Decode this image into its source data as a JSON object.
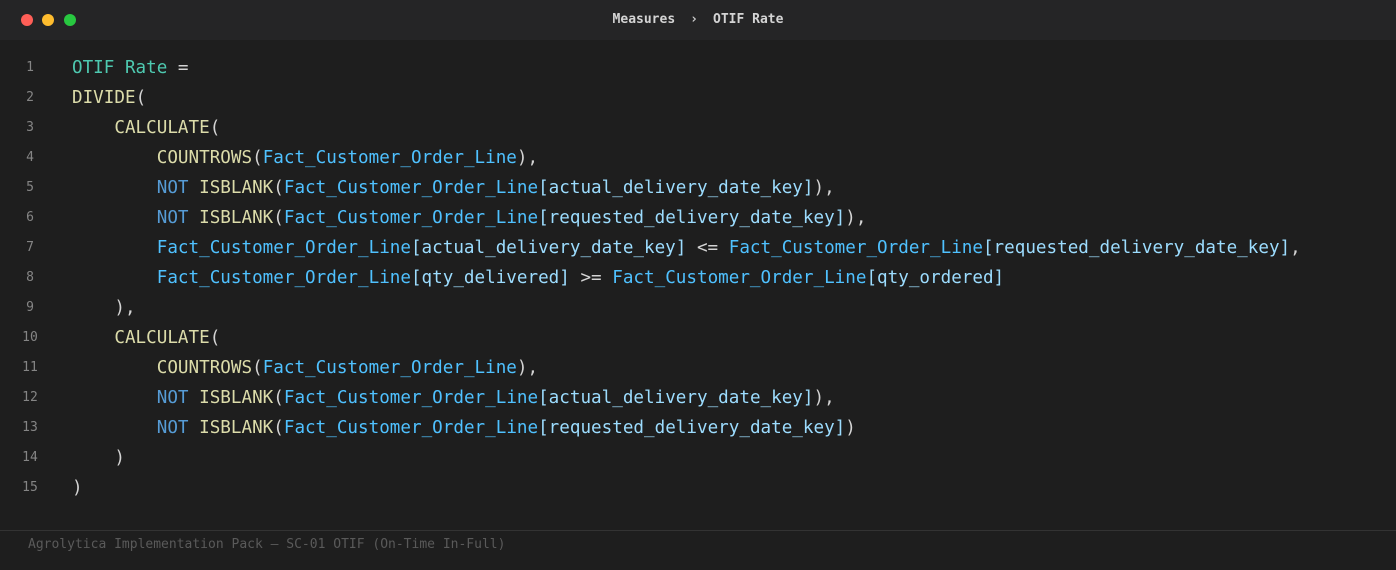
{
  "window": {
    "controls": [
      "close",
      "minimize",
      "maximize"
    ],
    "colors": {
      "close": "#ff5f57",
      "minimize": "#febc2e",
      "maximize": "#28c840"
    }
  },
  "breadcrumb": {
    "parent": "Measures",
    "separator": "›",
    "current": "OTIF Rate"
  },
  "editor": {
    "language": "DAX",
    "lines": [
      {
        "number": "1",
        "tokens": [
          {
            "t": "OTIF Rate",
            "k": "measure"
          },
          {
            "t": " =",
            "k": "punct"
          }
        ]
      },
      {
        "number": "2",
        "tokens": [
          {
            "t": "DIVIDE",
            "k": "func"
          },
          {
            "t": "(",
            "k": "punct"
          }
        ]
      },
      {
        "number": "3",
        "tokens": [
          {
            "t": "    ",
            "k": "punct"
          },
          {
            "t": "CALCULATE",
            "k": "func"
          },
          {
            "t": "(",
            "k": "punct"
          }
        ]
      },
      {
        "number": "4",
        "tokens": [
          {
            "t": "        ",
            "k": "punct"
          },
          {
            "t": "COUNTROWS",
            "k": "func"
          },
          {
            "t": "(",
            "k": "punct"
          },
          {
            "t": "Fact_Customer_Order_Line",
            "k": "table"
          },
          {
            "t": "),",
            "k": "punct"
          }
        ]
      },
      {
        "number": "5",
        "tokens": [
          {
            "t": "        ",
            "k": "punct"
          },
          {
            "t": "NOT",
            "k": "kw"
          },
          {
            "t": " ",
            "k": "punct"
          },
          {
            "t": "ISBLANK",
            "k": "func"
          },
          {
            "t": "(",
            "k": "punct"
          },
          {
            "t": "Fact_Customer_Order_Line",
            "k": "table"
          },
          {
            "t": "[actual_delivery_date_key]",
            "k": "col"
          },
          {
            "t": "),",
            "k": "punct"
          }
        ]
      },
      {
        "number": "6",
        "tokens": [
          {
            "t": "        ",
            "k": "punct"
          },
          {
            "t": "NOT",
            "k": "kw"
          },
          {
            "t": " ",
            "k": "punct"
          },
          {
            "t": "ISBLANK",
            "k": "func"
          },
          {
            "t": "(",
            "k": "punct"
          },
          {
            "t": "Fact_Customer_Order_Line",
            "k": "table"
          },
          {
            "t": "[requested_delivery_date_key]",
            "k": "col"
          },
          {
            "t": "),",
            "k": "punct"
          }
        ]
      },
      {
        "number": "7",
        "tokens": [
          {
            "t": "        ",
            "k": "punct"
          },
          {
            "t": "Fact_Customer_Order_Line",
            "k": "table"
          },
          {
            "t": "[actual_delivery_date_key]",
            "k": "col"
          },
          {
            "t": " <= ",
            "k": "punct"
          },
          {
            "t": "Fact_Customer_Order_Line",
            "k": "table"
          },
          {
            "t": "[requested_delivery_date_key]",
            "k": "col"
          },
          {
            "t": ",",
            "k": "punct"
          }
        ]
      },
      {
        "number": "8",
        "tokens": [
          {
            "t": "        ",
            "k": "punct"
          },
          {
            "t": "Fact_Customer_Order_Line",
            "k": "table"
          },
          {
            "t": "[qty_delivered]",
            "k": "col"
          },
          {
            "t": " >= ",
            "k": "punct"
          },
          {
            "t": "Fact_Customer_Order_Line",
            "k": "table"
          },
          {
            "t": "[qty_ordered]",
            "k": "col"
          }
        ]
      },
      {
        "number": "9",
        "tokens": [
          {
            "t": "    ),",
            "k": "punct"
          }
        ]
      },
      {
        "number": "10",
        "tokens": [
          {
            "t": "    ",
            "k": "punct"
          },
          {
            "t": "CALCULATE",
            "k": "func"
          },
          {
            "t": "(",
            "k": "punct"
          }
        ]
      },
      {
        "number": "11",
        "tokens": [
          {
            "t": "        ",
            "k": "punct"
          },
          {
            "t": "COUNTROWS",
            "k": "func"
          },
          {
            "t": "(",
            "k": "punct"
          },
          {
            "t": "Fact_Customer_Order_Line",
            "k": "table"
          },
          {
            "t": "),",
            "k": "punct"
          }
        ]
      },
      {
        "number": "12",
        "tokens": [
          {
            "t": "        ",
            "k": "punct"
          },
          {
            "t": "NOT",
            "k": "kw"
          },
          {
            "t": " ",
            "k": "punct"
          },
          {
            "t": "ISBLANK",
            "k": "func"
          },
          {
            "t": "(",
            "k": "punct"
          },
          {
            "t": "Fact_Customer_Order_Line",
            "k": "table"
          },
          {
            "t": "[actual_delivery_date_key]",
            "k": "col"
          },
          {
            "t": "),",
            "k": "punct"
          }
        ]
      },
      {
        "number": "13",
        "tokens": [
          {
            "t": "        ",
            "k": "punct"
          },
          {
            "t": "NOT",
            "k": "kw"
          },
          {
            "t": " ",
            "k": "punct"
          },
          {
            "t": "ISBLANK",
            "k": "func"
          },
          {
            "t": "(",
            "k": "punct"
          },
          {
            "t": "Fact_Customer_Order_Line",
            "k": "table"
          },
          {
            "t": "[requested_delivery_date_key]",
            "k": "col"
          },
          {
            "t": ")",
            "k": "punct"
          }
        ]
      },
      {
        "number": "14",
        "tokens": [
          {
            "t": "    )",
            "k": "punct"
          }
        ]
      },
      {
        "number": "15",
        "tokens": [
          {
            "t": ")",
            "k": "punct"
          }
        ]
      }
    ],
    "token_colors": {
      "measure": "#4ec9b0",
      "func": "#dcdcaa",
      "kw": "#569cd6",
      "table": "#4fc1ff",
      "col": "#9cdcfe",
      "punct": "#d4d4d4"
    }
  },
  "footer": {
    "text": "Agrolytica Implementation Pack — SC-01 OTIF (On-Time In-Full)"
  }
}
